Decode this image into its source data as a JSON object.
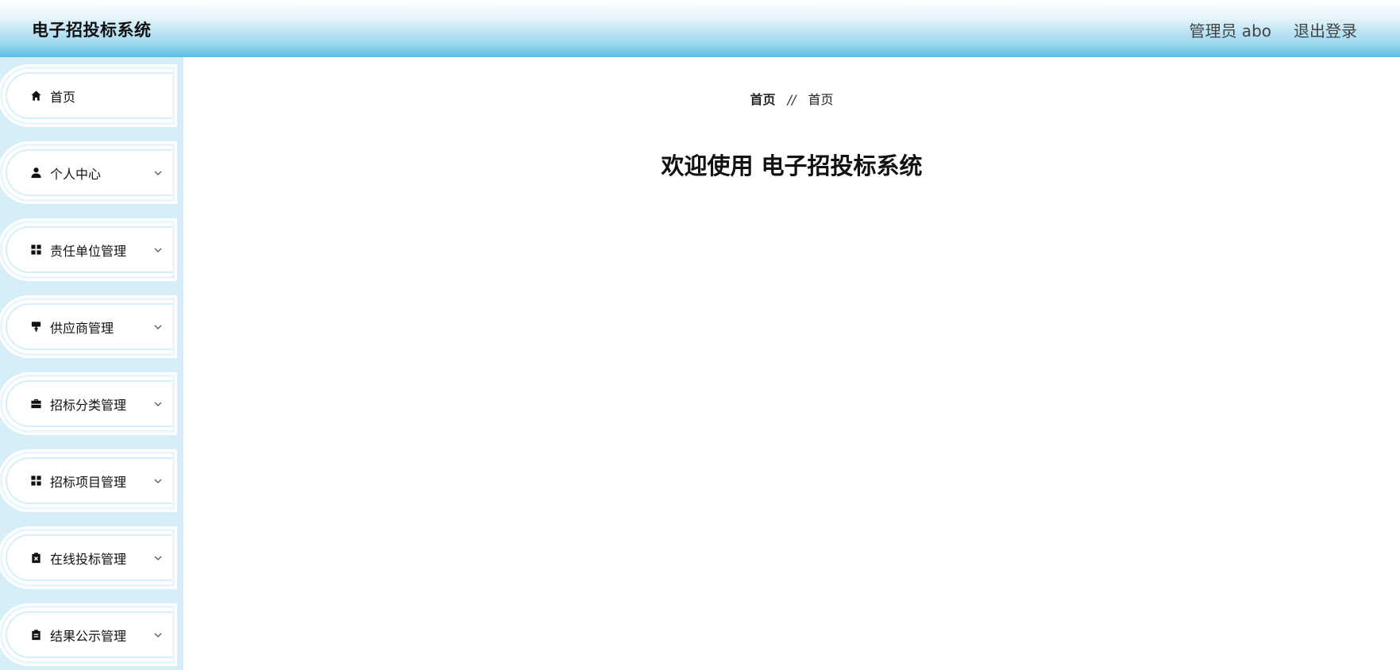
{
  "header": {
    "title": "电子招投标系统",
    "user": "管理员 abo",
    "logout": "退出登录"
  },
  "sidebar": {
    "items": [
      {
        "label": "首页",
        "icon": "home-icon",
        "expandable": false
      },
      {
        "label": "个人中心",
        "icon": "user-icon",
        "expandable": true
      },
      {
        "label": "责任单位管理",
        "icon": "grid-icon",
        "expandable": true
      },
      {
        "label": "供应商管理",
        "icon": "paint-roller-icon",
        "expandable": true
      },
      {
        "label": "招标分类管理",
        "icon": "briefcase-icon",
        "expandable": true
      },
      {
        "label": "招标项目管理",
        "icon": "grid-icon",
        "expandable": true
      },
      {
        "label": "在线投标管理",
        "icon": "clipboard-x-icon",
        "expandable": true
      },
      {
        "label": "结果公示管理",
        "icon": "clipboard-icon",
        "expandable": true
      }
    ]
  },
  "breadcrumb": {
    "home": "首页",
    "separator": "//",
    "current": "首页"
  },
  "main": {
    "welcome": "欢迎使用 电子招投标系统"
  },
  "colors": {
    "header_gradient_bottom": "#5bbfe3",
    "sidebar_bg": "#d6eef7"
  }
}
